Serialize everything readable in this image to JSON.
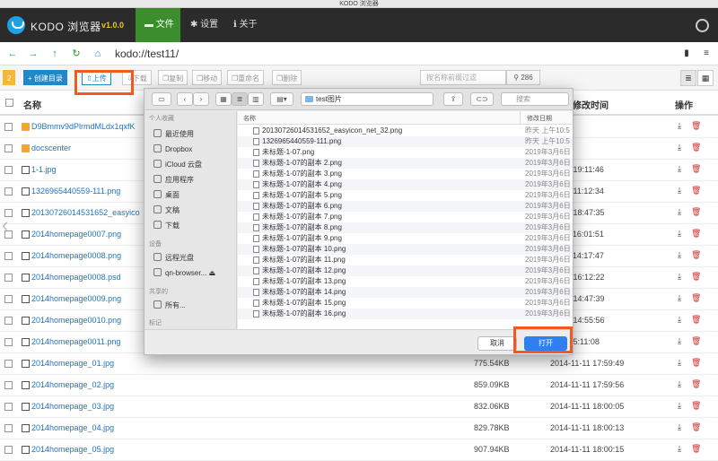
{
  "window_title": "KODO 浏览器",
  "app": {
    "brand": "KODO 浏览器",
    "version": "v1.0.0",
    "nav": [
      "文件",
      "设置",
      "关于"
    ],
    "user_icon": "user-icon"
  },
  "address": {
    "path": "kodo://test11/"
  },
  "toolbar": {
    "count_badge": "2",
    "create_dir": "创建目录",
    "upload": "上传",
    "download": "下载",
    "copy": "复制",
    "move": "移动",
    "rename": "重命名",
    "delete": "删除",
    "search_placeholder": "按名称前缀过滤",
    "search_count": "286"
  },
  "table": {
    "headers": {
      "name": "名称",
      "time": "修改时间",
      "action": "操作"
    },
    "rows": [
      {
        "name": "D9Bmmv9dPlrmdMLdx1qxfK",
        "type": "folder",
        "size": "",
        "time": ""
      },
      {
        "name": "docscenter",
        "type": "folder",
        "size": "",
        "time": ""
      },
      {
        "name": "1-1.jpg",
        "type": "file",
        "size": "",
        "time": "07-22 19:11:46"
      },
      {
        "name": "1326965440559-111.png",
        "type": "file",
        "size": "",
        "time": "07-22 11:12:34"
      },
      {
        "name": "20130726014531652_easyico",
        "type": "file",
        "size": "",
        "time": "08-14 18:47:35"
      },
      {
        "name": "2014homepage0007.png",
        "type": "file",
        "size": "",
        "time": "11-17 16:01:51"
      },
      {
        "name": "2014homepage0008.png",
        "type": "file",
        "size": "",
        "time": "11-26 14:17:47"
      },
      {
        "name": "2014homepage0008.psd",
        "type": "file",
        "size": "",
        "time": "12-16 16:12:22"
      },
      {
        "name": "2014homepage0009.png",
        "type": "file",
        "size": "",
        "time": "12-01 14:47:39"
      },
      {
        "name": "2014homepage0010.png",
        "type": "file",
        "size": "",
        "time": "12-01 14:55:56"
      },
      {
        "name": "2014homepage0011.png",
        "type": "file",
        "size": "",
        "time": "2-01 15:11:08"
      },
      {
        "name": "2014homepage_01.jpg",
        "type": "file",
        "size": "775.54KB",
        "time": "2014-11-11 17:59:49"
      },
      {
        "name": "2014homepage_02.jpg",
        "type": "file",
        "size": "859.09KB",
        "time": "2014-11-11 17:59:56"
      },
      {
        "name": "2014homepage_03.jpg",
        "type": "file",
        "size": "832.06KB",
        "time": "2014-11-11 18:00:05"
      },
      {
        "name": "2014homepage_04.jpg",
        "type": "file",
        "size": "829.78KB",
        "time": "2014-11-11 18:00:13"
      },
      {
        "name": "2014homepage_05.jpg",
        "type": "file",
        "size": "907.94KB",
        "time": "2014-11-11 18:00:15"
      }
    ]
  },
  "dialog": {
    "folder": "test图片",
    "search_placeholder": "搜索",
    "sidebar": {
      "favorites_header": "个人收藏",
      "favorites": [
        "最近使用",
        "Dropbox",
        "iCloud 云盘",
        "应用程序",
        "桌面",
        "文稿",
        "下载"
      ],
      "devices_header": "设备",
      "devices": [
        "远程光盘",
        "qn-browser..."
      ],
      "shared_header": "共享的",
      "shared": [
        "所有..."
      ],
      "tags_header": "标记"
    },
    "columns": {
      "name": "名称",
      "date": "修改日期"
    },
    "files": [
      {
        "name": "20130726014531652_easyicon_net_32.png",
        "date": "昨天 上午10:5"
      },
      {
        "name": "1326965440559-111.png",
        "date": "昨天 上午10:5"
      },
      {
        "name": "未标题-1-07.png",
        "date": "2019年3月6日"
      },
      {
        "name": "未标题-1-07的副本 2.png",
        "date": "2019年3月6日"
      },
      {
        "name": "未标题-1-07的副本 3.png",
        "date": "2019年3月6日"
      },
      {
        "name": "未标题-1-07的副本 4.png",
        "date": "2019年3月6日"
      },
      {
        "name": "未标题-1-07的副本 5.png",
        "date": "2019年3月6日"
      },
      {
        "name": "未标题-1-07的副本 6.png",
        "date": "2019年3月6日"
      },
      {
        "name": "未标题-1-07的副本 7.png",
        "date": "2019年3月6日"
      },
      {
        "name": "未标题-1-07的副本 8.png",
        "date": "2019年3月6日"
      },
      {
        "name": "未标题-1-07的副本 9.png",
        "date": "2019年3月6日"
      },
      {
        "name": "未标题-1-07的副本 10.png",
        "date": "2019年3月6日"
      },
      {
        "name": "未标题-1-07的副本 11.png",
        "date": "2019年3月6日"
      },
      {
        "name": "未标题-1-07的副本 12.png",
        "date": "2019年3月6日"
      },
      {
        "name": "未标题-1-07的副本 13.png",
        "date": "2019年3月6日"
      },
      {
        "name": "未标题-1-07的副本 14.png",
        "date": "2019年3月6日"
      },
      {
        "name": "未标题-1-07的副本 15.png",
        "date": "2019年3月6日"
      },
      {
        "name": "未标题-1-07的副本 16.png",
        "date": "2019年3月6日"
      }
    ],
    "cancel": "取消",
    "open": "打开"
  },
  "colors": {
    "accent": "#1e88c8",
    "nav_active": "#3c8d2c",
    "highlight": "#f05a1e",
    "open_button": "#2f7ff0"
  }
}
